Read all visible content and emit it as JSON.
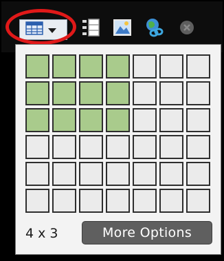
{
  "toolbar": {
    "buttons": [
      {
        "name": "table-icon"
      },
      {
        "name": "chevron-down-icon"
      },
      {
        "name": "layout-icon"
      },
      {
        "name": "image-icon"
      },
      {
        "name": "link-icon"
      },
      {
        "name": "close-icon"
      }
    ]
  },
  "colors": {
    "selected_cell": "#a9cb8c",
    "unselected_cell": "#ebebeb",
    "highlight_ring": "#e01919",
    "more_button": "#5f5f5f"
  },
  "grid": {
    "columns": 7,
    "rows": 6,
    "selected_columns": 4,
    "selected_rows": 3
  },
  "footer": {
    "size_label": "4 x 3",
    "more_options_label": "More Options"
  }
}
